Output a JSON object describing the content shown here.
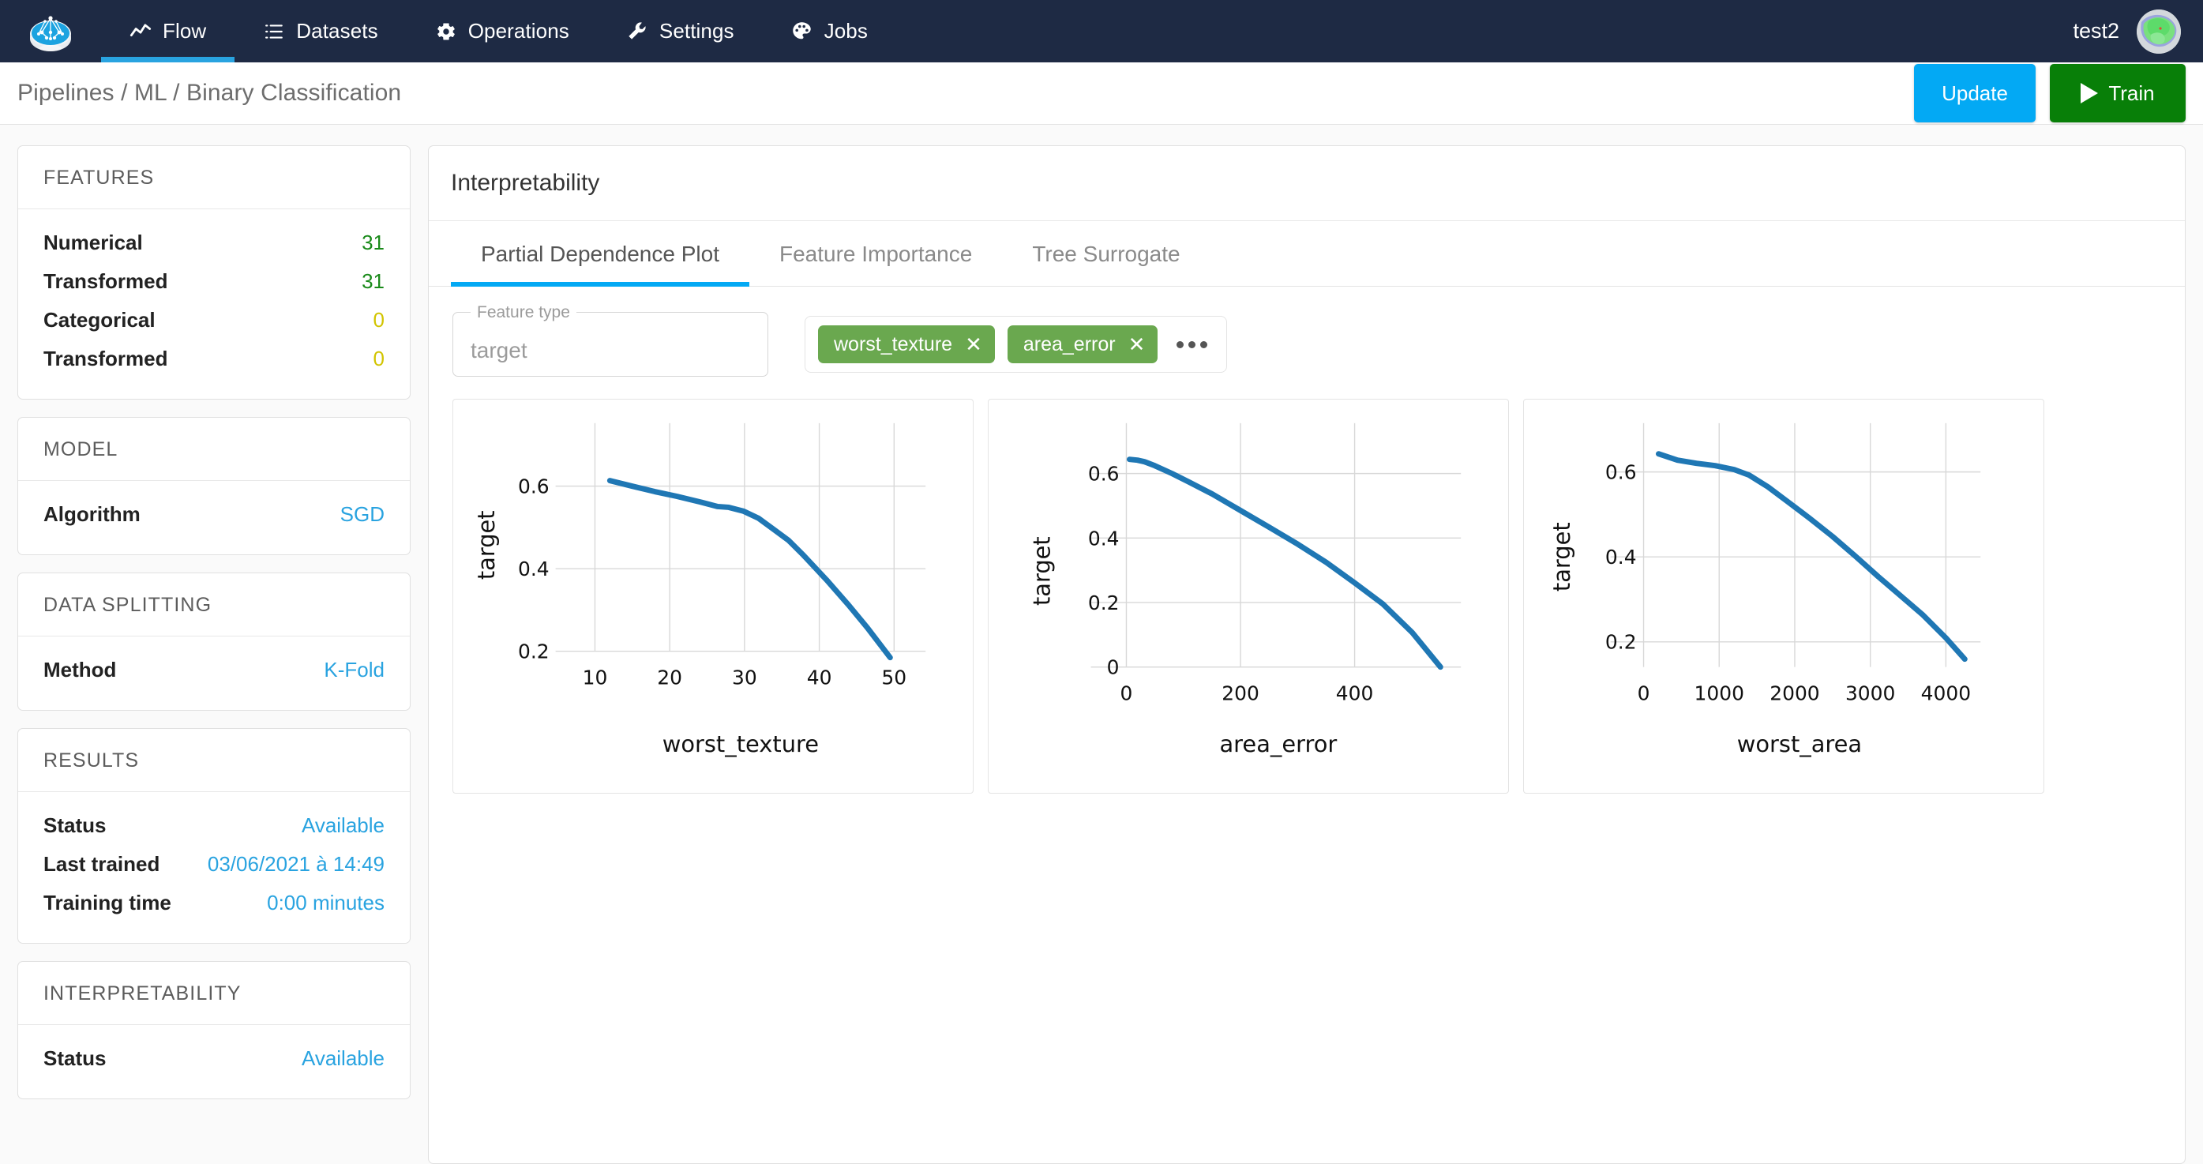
{
  "topnav": {
    "logo_icon": "dataiku-logo-icon",
    "items": [
      {
        "label": "Flow",
        "icon": "activity-line-icon",
        "active": true
      },
      {
        "label": "Datasets",
        "icon": "list-icon",
        "active": false
      },
      {
        "label": "Operations",
        "icon": "gear-icon",
        "active": false
      },
      {
        "label": "Settings",
        "icon": "wrench-icon",
        "active": false
      },
      {
        "label": "Jobs",
        "icon": "palette-icon",
        "active": false
      }
    ],
    "user_name": "test2",
    "active_indicator_color": "#29a3e0",
    "background_color": "#1e2a44"
  },
  "breadcrumb": {
    "items": [
      "Pipelines",
      "ML",
      "Binary Classification"
    ],
    "separator": "/",
    "full_text": "Pipelines / ML / Binary Classification",
    "update_label": "Update",
    "train_label": "Train",
    "update_color": "#03a9f4",
    "train_color": "#087f08",
    "train_icon": "play-icon"
  },
  "sidebar": {
    "cards": [
      {
        "title": "FEATURES",
        "rows": [
          {
            "key": "Numerical",
            "value": "31",
            "value_color": "green"
          },
          {
            "key": "Transformed",
            "value": "31",
            "value_color": "green"
          },
          {
            "key": "Categorical",
            "value": "0",
            "value_color": "yellow"
          },
          {
            "key": "Transformed",
            "value": "0",
            "value_color": "yellow"
          }
        ]
      },
      {
        "title": "MODEL",
        "rows": [
          {
            "key": "Algorithm",
            "value": "SGD",
            "value_color": "blue"
          }
        ]
      },
      {
        "title": "DATA SPLITTING",
        "rows": [
          {
            "key": "Method",
            "value": "K-Fold",
            "value_color": "blue"
          }
        ]
      },
      {
        "title": "RESULTS",
        "rows": [
          {
            "key": "Status",
            "value": "Available",
            "value_color": "blue"
          },
          {
            "key": "Last trained",
            "value": "03/06/2021 à 14:49",
            "value_color": "blue"
          },
          {
            "key": "Training time",
            "value": "0:00 minutes",
            "value_color": "blue"
          }
        ]
      },
      {
        "title": "INTERPRETABILITY",
        "rows": [
          {
            "key": "Status",
            "value": "Available",
            "value_color": "blue"
          }
        ]
      }
    ]
  },
  "main": {
    "title": "Interpretability",
    "tabs": [
      {
        "label": "Partial Dependence Plot",
        "active": true
      },
      {
        "label": "Feature Importance",
        "active": false
      },
      {
        "label": "Tree Surrogate",
        "active": false
      }
    ],
    "feature_type_field": {
      "label": "Feature type",
      "value": "target",
      "placeholder": "target"
    },
    "chips": [
      {
        "label": "worst_texture",
        "remove_icon": "close-icon"
      },
      {
        "label": "area_error",
        "remove_icon": "close-icon"
      }
    ],
    "chip_color": "#6aa84f",
    "more_icon": "ellipsis-icon"
  },
  "chart_data": [
    {
      "type": "line",
      "title": "",
      "xlabel": "worst_texture",
      "ylabel": "target",
      "xlim": [
        7.0,
        55.5
      ],
      "ylim": [
        0.155,
        0.735
      ],
      "xticks": [
        10,
        20,
        30,
        40,
        50
      ],
      "yticks": [
        0.2,
        0.4,
        0.6
      ],
      "ytick_labels": [
        "0.2",
        "0.4",
        "0.6"
      ],
      "grid": true,
      "legend": null,
      "line_color": "#1f77b4",
      "x": [
        12.0,
        15.0,
        18.0,
        21.0,
        24.0,
        26.5,
        28.0,
        30.0,
        32.0,
        34.0,
        36.0,
        38.0,
        41.0,
        44.0,
        46.5,
        49.5
      ],
      "y": [
        0.686,
        0.672,
        0.66,
        0.648,
        0.635,
        0.623,
        0.621,
        0.612,
        0.594,
        0.568,
        0.54,
        0.505,
        0.445,
        0.385,
        0.33,
        0.256
      ]
    },
    {
      "type": "line",
      "title": "",
      "xlabel": "area_error",
      "ylabel": "target",
      "xlim": [
        -40,
        600
      ],
      "ylim": [
        -0.055,
        0.705
      ],
      "xticks": [
        0,
        200,
        400
      ],
      "yticks": [
        0,
        0.2,
        0.4,
        0.6
      ],
      "ytick_labels": [
        "0",
        "0.2",
        "0.4",
        "0.6"
      ],
      "grid": true,
      "legend": null,
      "line_color": "#1f77b4",
      "x": [
        6,
        20,
        32,
        50,
        80,
        110,
        150,
        200,
        250,
        300,
        350,
        400,
        450,
        500,
        550
      ],
      "y": [
        0.645,
        0.644,
        0.638,
        0.627,
        0.603,
        0.576,
        0.54,
        0.489,
        0.437,
        0.383,
        0.325,
        0.263,
        0.196,
        0.11,
        0.0
      ]
    },
    {
      "type": "line",
      "title": "",
      "xlabel": "worst_area",
      "ylabel": "target",
      "xlim": [
        -230,
        4700
      ],
      "ylim": [
        0.125,
        0.705
      ],
      "xticks": [
        0,
        1000,
        2000,
        3000,
        4000
      ],
      "yticks": [
        0.2,
        0.4,
        0.6
      ],
      "ytick_labels": [
        "0.2",
        "0.4",
        "0.6"
      ],
      "grid": true,
      "legend": null,
      "line_color": "#1f77b4",
      "x": [
        200,
        450,
        700,
        950,
        1200,
        1400,
        1650,
        1900,
        2200,
        2500,
        2800,
        3100,
        3400,
        3700,
        4000,
        4250
      ],
      "y": [
        0.662,
        0.648,
        0.641,
        0.636,
        0.626,
        0.613,
        0.586,
        0.553,
        0.512,
        0.47,
        0.423,
        0.376,
        0.331,
        0.285,
        0.232,
        0.182
      ]
    }
  ]
}
